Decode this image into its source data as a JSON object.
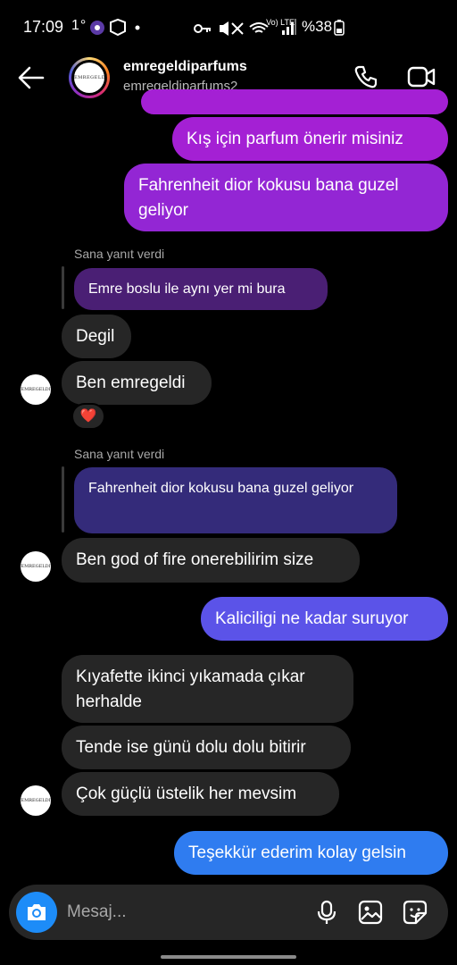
{
  "status_bar": {
    "time": "17:09",
    "extra": "1°",
    "battery": "%38",
    "network": "Vo) LTE"
  },
  "header": {
    "name": "emregeldiparfums",
    "username": "emregeldiparfums2",
    "avatar_text": "EMREGELDI"
  },
  "messages": {
    "out_winter": "Kış için parfum önerir misiniz",
    "out_fahrenheit": "Fahrenheit dior kokusu bana guzel geliyor",
    "reply_label_1": "Sana yanıt verdi",
    "quote_1": "Emre boslu ile aynı yer mi bura",
    "in_degil": "Degil",
    "in_ben": "Ben emregeldi",
    "reaction": "❤️",
    "reply_label_2": "Sana yanıt verdi",
    "quote_2": "Fahrenheit dior kokusu bana guzel geliyor",
    "in_god": "Ben god of fire onerebilirim size",
    "out_kalici": "Kaliciligi ne kadar suruyor",
    "in_kiyafet": "Kıyafette ikinci yıkamada çıkar herhalde",
    "in_tende": "Tende ise günü dolu dolu bitirir",
    "in_cok": "Çok güçlü üstelik her mevsim",
    "out_tesekkur": "Teşekkür ederim kolay gelsin"
  },
  "composer": {
    "placeholder": "Mesaj..."
  },
  "icons": [
    "back-arrow-icon",
    "phone-icon",
    "video-icon",
    "camera-icon",
    "microphone-icon",
    "gallery-icon",
    "sticker-icon"
  ],
  "colors": {
    "background": "#000000",
    "incoming": "#262626",
    "outgoing_purple": "#a420d4",
    "outgoing_blue": "#2f7cf0",
    "camera_button": "#1d8cf8"
  }
}
